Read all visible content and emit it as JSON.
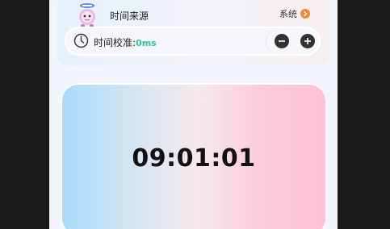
{
  "time_source": {
    "label": "时间来源",
    "value": "系统",
    "icon": "alarm-clock-mascot-icon",
    "accent_color": "#f0892f"
  },
  "calibration": {
    "label": "时间校准:",
    "value": "0ms",
    "value_color": "#2fc2a2",
    "icon": "clock-icon",
    "decrement_icon": "minus-icon",
    "increment_icon": "plus-icon"
  },
  "display": {
    "time": "09:01:01"
  }
}
